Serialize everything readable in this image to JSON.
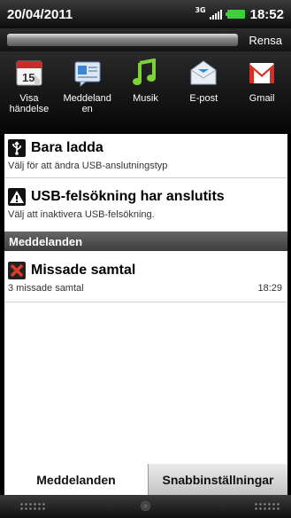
{
  "status": {
    "date": "20/04/2011",
    "network": "3G",
    "time": "18:52"
  },
  "clear_button": "Rensa",
  "shortcuts": [
    {
      "label": "Visa\nhändelse",
      "icon": "calendar-icon",
      "calendar_day": "15"
    },
    {
      "label": "Meddeland\nen",
      "icon": "messages-icon"
    },
    {
      "label": "Musik",
      "icon": "music-icon"
    },
    {
      "label": "E-post",
      "icon": "email-icon"
    },
    {
      "label": "Gmail",
      "icon": "gmail-icon"
    }
  ],
  "notifications": [
    {
      "title": "Bara ladda",
      "sub": "Välj för att ändra USB-anslutningstyp",
      "icon": "usb-icon"
    },
    {
      "title": "USB-felsökning har anslutits",
      "sub": "Välj att inaktivera USB-felsökning.",
      "icon": "warning-icon"
    }
  ],
  "section_header": "Meddelanden",
  "messages": [
    {
      "title": "Missade samtal",
      "sub": "3 missade samtal",
      "time": "18:29",
      "icon": "missed-call-icon"
    }
  ],
  "tabs": {
    "active": "Meddelanden",
    "inactive": "Snabbinställningar"
  },
  "colors": {
    "battery": "#3cd03c",
    "music_green": "#7fd13b",
    "gmail_red": "#d93025"
  }
}
